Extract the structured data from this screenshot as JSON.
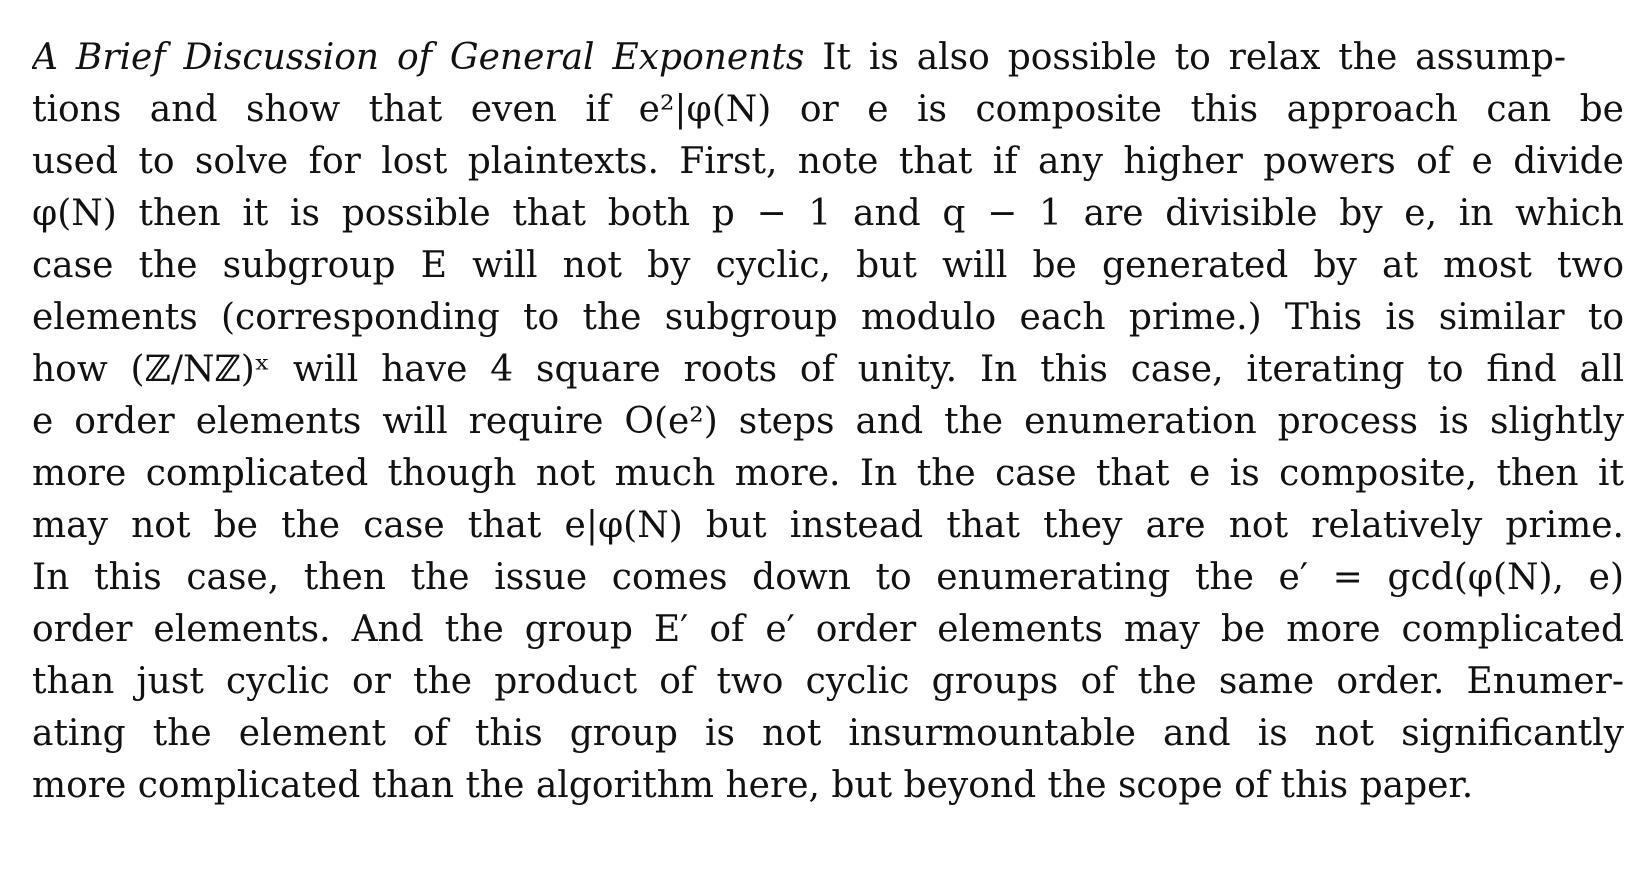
{
  "paragraph": {
    "heading": "A Brief Discussion of General Exponents",
    "lines": [
      "It is also possible to relax the assump-",
      "tions and show that even if e²|φ(N) or e is composite this approach can be",
      "used to solve for lost plaintexts. First, note that if any higher powers of e divide",
      "φ(N) then it is possible that both p − 1 and q − 1 are divisible by e, in which",
      "case the subgroup E will not by cyclic, but will be generated by at most two",
      "elements (corresponding to the subgroup modulo each prime.) This is similar to",
      "how (ℤ/Nℤ)ˣ will have 4 square roots of unity. In this case, iterating to find all",
      "e order elements will require O(e²) steps and the enumeration process is slightly",
      "more complicated though not much more. In the case that e is composite, then it",
      "may not be the case that e|φ(N) but instead that they are not relatively prime.",
      "In this case, then the issue comes down to enumerating the e′ = gcd(φ(N), e)",
      "order elements. And the group E′ of e′ order elements may be more complicated",
      "than just cyclic or the product of two cyclic groups of the same order. Enumer-",
      "ating the element of this group is not insurmountable and is not significantly",
      "more complicated than the algorithm here, but beyond the scope of this paper."
    ]
  }
}
